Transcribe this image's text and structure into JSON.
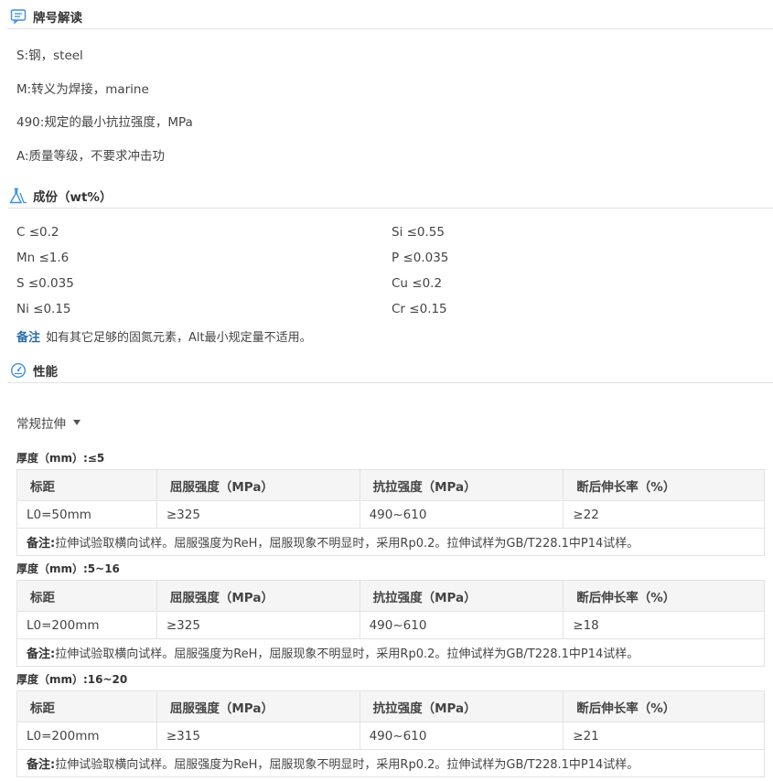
{
  "sections": {
    "grade": {
      "title": "牌号解读"
    },
    "composition": {
      "title": "成份（wt%）"
    },
    "properties": {
      "title": "性能"
    }
  },
  "grade_lines": [
    "S:钢，steel",
    "M:转义为焊接，marine",
    "490:规定的最小抗拉强度，MPa",
    "A:质量等级，不要求冲击功"
  ],
  "composition": {
    "items": [
      "C ≤0.2",
      "Si ≤0.55",
      "Mn ≤1.6",
      "P ≤0.035",
      "S ≤0.035",
      "Cu ≤0.2",
      "Ni ≤0.15",
      "Cr ≤0.15"
    ],
    "note_key": "备注",
    "note_text": "如有其它足够的固氮元素，Alt最小规定量不适用。"
  },
  "test_type": "常规拉伸",
  "headers": [
    "标距",
    "屈服强度（MPa）",
    "抗拉强度（MPa）",
    "断后伸长率（%）"
  ],
  "tables": [
    {
      "thickness": "厚度（mm）:≤5",
      "row": [
        "L0=50mm",
        "≥325",
        "490~610",
        "≥22"
      ],
      "note_key": "备注:",
      "note_text": "拉伸试验取横向试样。屈服强度为ReH，屈服现象不明显时，采用Rp0.2。拉伸试样为GB/T228.1中P14试样。"
    },
    {
      "thickness": "厚度（mm）:5~16",
      "row": [
        "L0=200mm",
        "≥325",
        "490~610",
        "≥18"
      ],
      "note_key": "备注:",
      "note_text": "拉伸试验取横向试样。屈服强度为ReH，屈服现象不明显时，采用Rp0.2。拉伸试样为GB/T228.1中P14试样。"
    },
    {
      "thickness": "厚度（mm）:16~20",
      "row": [
        "L0=200mm",
        "≥315",
        "490~610",
        "≥21"
      ],
      "note_key": "备注:",
      "note_text": "拉伸试验取横向试样。屈服强度为ReH，屈服现象不明显时，采用Rp0.2。拉伸试样为GB/T228.1中P14试样。"
    }
  ]
}
